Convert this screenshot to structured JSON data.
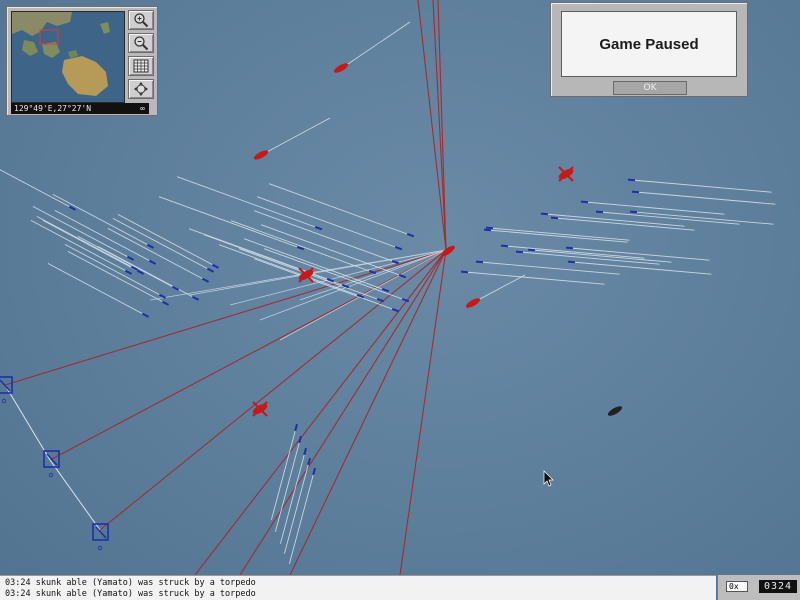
{
  "minimap": {
    "coords": "129°49'E,27°27'N",
    "zoom_level": "∞"
  },
  "toolbar": [
    {
      "icon": "zoom-in-icon"
    },
    {
      "icon": "zoom-out-icon"
    },
    {
      "icon": "grid-icon"
    },
    {
      "icon": "center-view-icon"
    }
  ],
  "dialog": {
    "title": "Game Paused",
    "ok_label": "OK"
  },
  "log": {
    "messages": [
      "03:24 skunk able (Yamato) was struck by a torpedo",
      "03:24 skunk able (Yamato) was struck by a torpedo"
    ]
  },
  "time": {
    "speed": "0x",
    "clock": "0324"
  },
  "colors": {
    "ocean": "#5d7e9b",
    "enemy": "#c41a1a",
    "friendly": "#1e2fa8",
    "track": "#dbe4ec",
    "fire_line": "#a02222"
  }
}
